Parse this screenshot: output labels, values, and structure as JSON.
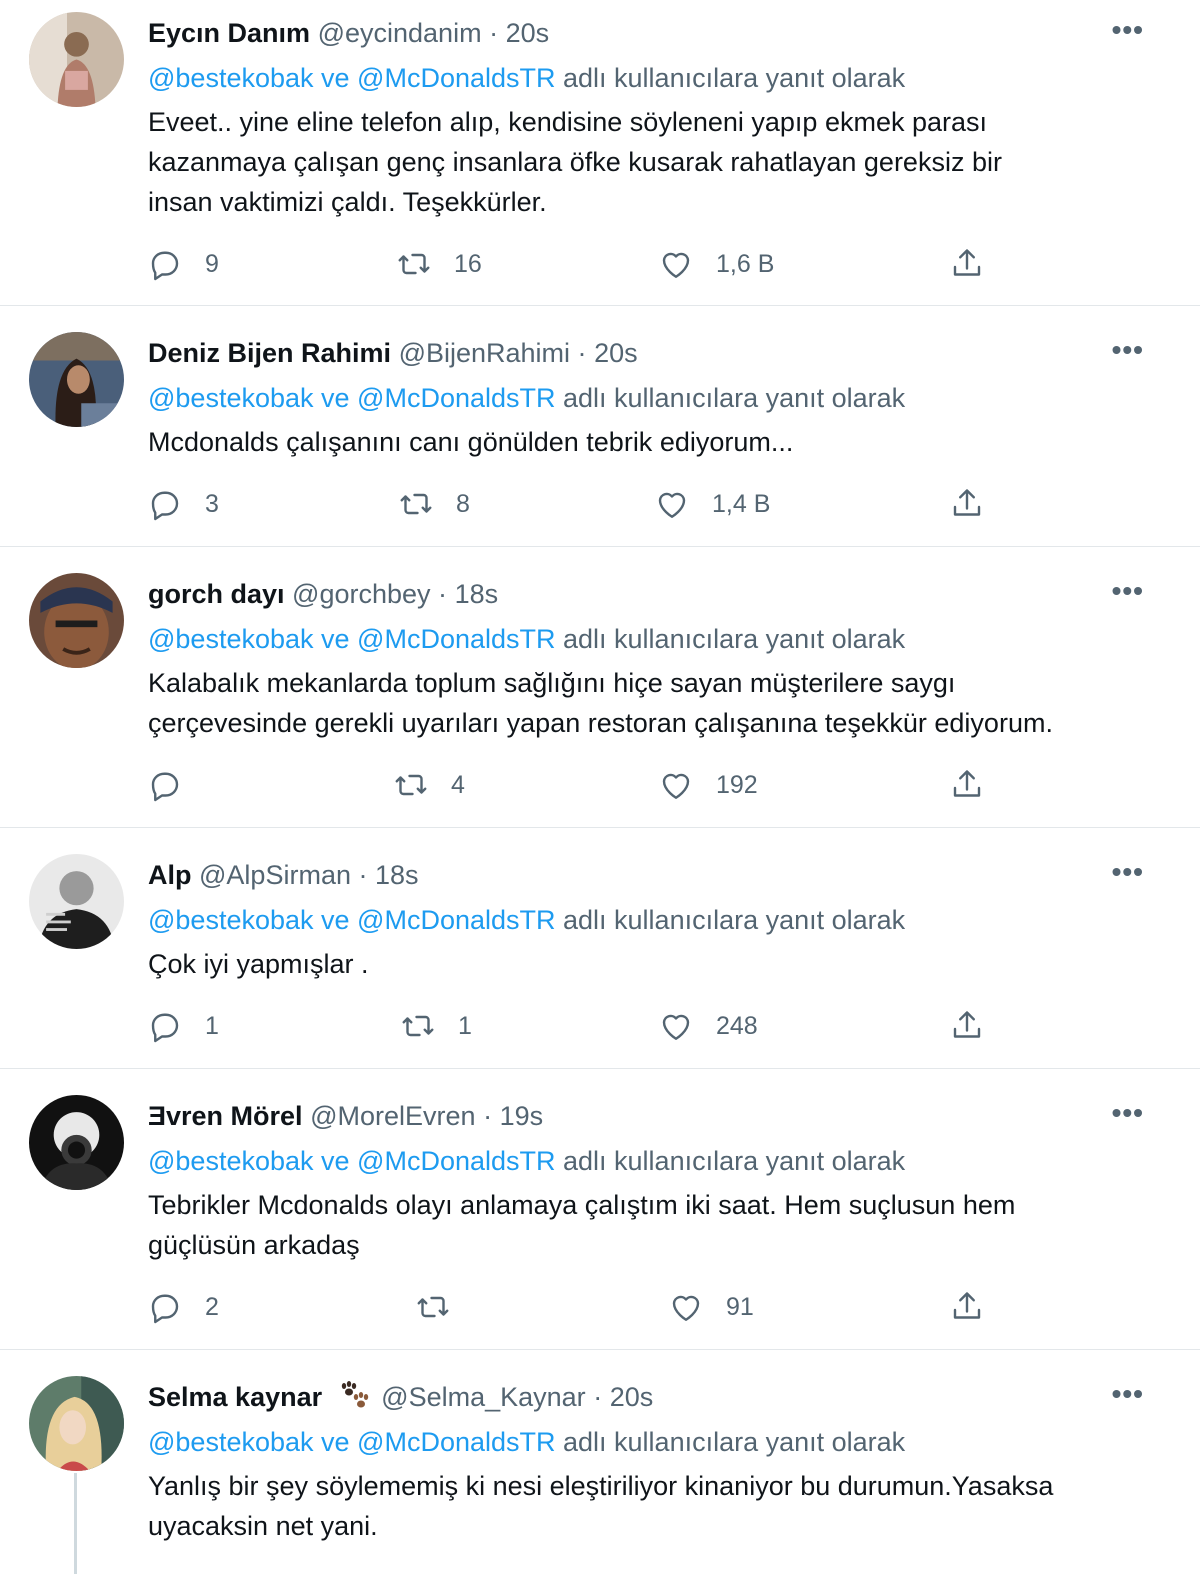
{
  "reply_text": {
    "and": " ve ",
    "suffix": " adlı kullanıcılara yanıt olarak"
  },
  "tweets": [
    {
      "name": "Eycın Danım",
      "handle": "@eycindanim",
      "time": "20s",
      "mentions": [
        "@bestekobak",
        "@McDonaldsTR"
      ],
      "lines": [
        "Eveet.. yine eline telefon alıp, kendisine söyleneni yapıp ekmek parası",
        "kazanmaya çalışan genç insanlara öfke kusarak rahatlayan gereksiz bir",
        "insan vaktimizi çaldı. Teşekkürler."
      ],
      "replies": "9",
      "retweets": "16",
      "likes": "1,6 B"
    },
    {
      "name": "Deniz Bijen Rahimi",
      "handle": "@BijenRahimi",
      "time": "20s",
      "mentions": [
        "@bestekobak",
        "@McDonaldsTR"
      ],
      "lines": [
        "Mcdonalds çalışanını canı gönülden tebrik ediyorum..."
      ],
      "replies": "3",
      "retweets": "8",
      "likes": "1,4 B"
    },
    {
      "name": "gorch dayı",
      "handle": "@gorchbey",
      "time": "18s",
      "mentions": [
        "@bestekobak",
        "@McDonaldsTR"
      ],
      "lines": [
        "Kalabalık mekanlarda toplum sağlığını hiçe sayan müşterilere saygı",
        "çerçevesinde gerekli uyarıları yapan restoran çalışanına teşekkür ediyorum."
      ],
      "replies": "",
      "retweets": "4",
      "likes": "192"
    },
    {
      "name": "Alp",
      "handle": "@AlpSirman",
      "time": "18s",
      "mentions": [
        "@bestekobak",
        "@McDonaldsTR"
      ],
      "lines": [
        "Çok iyi yapmışlar ."
      ],
      "replies": "1",
      "retweets": "1",
      "likes": "248"
    },
    {
      "name": "Ǝvren Mörel",
      "handle": "@MorelEvren",
      "time": "19s",
      "mentions": [
        "@bestekobak",
        "@McDonaldsTR"
      ],
      "lines": [
        "Tebrikler Mcdonalds olayı anlamaya çalıştım iki saat. Hem suçlusun hem",
        "güçlüsün arkadaş"
      ],
      "replies": "2",
      "retweets": "",
      "likes": "91"
    },
    {
      "name": "Selma kaynar",
      "handle": "@Selma_Kaynar",
      "time": "20s",
      "mentions": [
        "@bestekobak",
        "@McDonaldsTR"
      ],
      "lines": [
        "Yanlış bir şey söylememiş ki nesi eleştiriliyor kinaniyor bu durumun.Yasaksa",
        "uyacaksin net yani."
      ],
      "replies": "",
      "retweets": "",
      "likes": ""
    }
  ],
  "separator_dot": "·",
  "more_label": "•••",
  "name_badge_icon": "paw-prints-icon",
  "colors": {
    "link": "#1d9bf0",
    "secondary_text": "#536471",
    "primary_text": "#0f1419",
    "divider": "#e3e7ea"
  }
}
